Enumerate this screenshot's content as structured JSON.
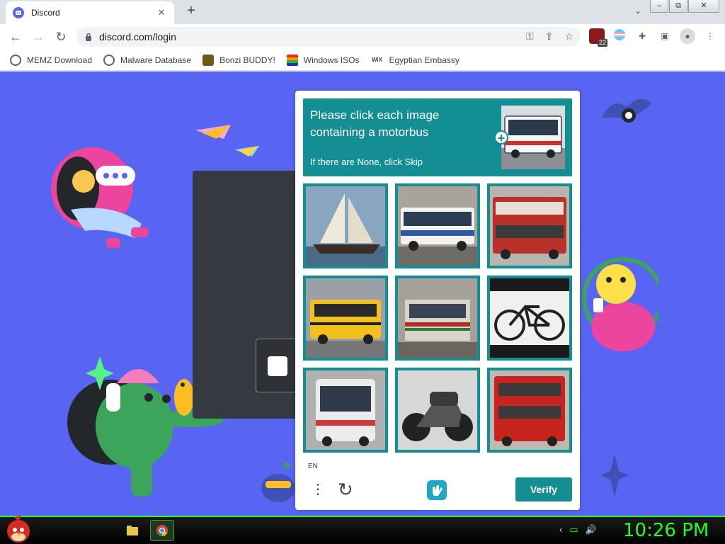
{
  "browser": {
    "tab_title": "Discord",
    "tab_close": "✕",
    "new_tab": "+",
    "tab_search": "⌄",
    "window_buttons": {
      "minimize": "–",
      "maximize": "⧉",
      "close": "✕"
    },
    "url": "discord.com/login",
    "nav": {
      "back": "←",
      "forward": "→",
      "reload": "↻"
    },
    "omnibox_icons": {
      "key": "⚿",
      "share": "⇪",
      "star": "☆"
    },
    "extensions": {
      "badge_count": "22",
      "puzzle": "✚",
      "sidepanel": "▣",
      "profile": "●",
      "menu": "⋮"
    },
    "bookmarks": [
      {
        "label": "MEMZ Download",
        "icon": "globe-icon",
        "color": "#5f6368"
      },
      {
        "label": "Malware Database",
        "icon": "globe-icon",
        "color": "#5f6368"
      },
      {
        "label": "Bonzi BUDDY!",
        "icon": "bonzi-icon",
        "color": "#7a5cc0"
      },
      {
        "label": "Windows ISOs",
        "icon": "windows-icon",
        "color": "#e34"
      },
      {
        "label": "Egyptian Embassy",
        "icon": "wix-icon",
        "color": "#000"
      }
    ]
  },
  "captcha": {
    "prompt_title": "Please click each image containing a motorbus",
    "prompt_sub": "If there are None, click Skip",
    "sample_label": "+",
    "language": "EN",
    "menu_dots": "⋮",
    "refresh": "↻",
    "verify_label": "Verify",
    "accent": "#138f93",
    "tiles": [
      {
        "subject": "sailboat"
      },
      {
        "subject": "bus"
      },
      {
        "subject": "bus"
      },
      {
        "subject": "school bus"
      },
      {
        "subject": "train"
      },
      {
        "subject": "bicycle"
      },
      {
        "subject": "bus"
      },
      {
        "subject": "motorcycle"
      },
      {
        "subject": "double-decker bus"
      }
    ]
  },
  "page": {
    "background": "#5865f2"
  },
  "taskbar": {
    "clock": "10:26 PM",
    "tray": {
      "back": "‹",
      "monitor": "▭",
      "volume": "🔊"
    }
  }
}
